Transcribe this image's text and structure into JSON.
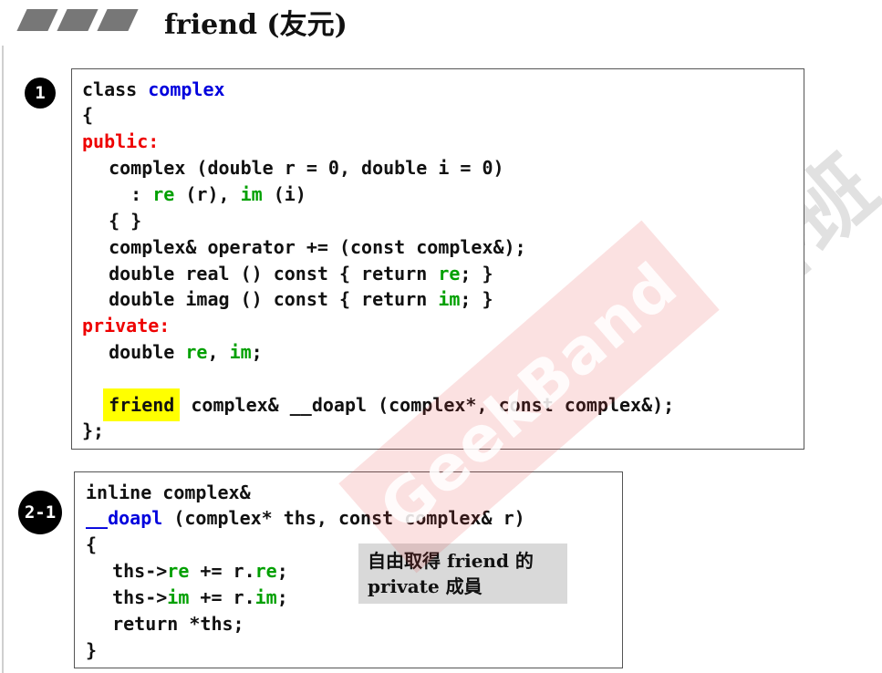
{
  "title": "friend (友元)",
  "badges": {
    "one": "1",
    "two": "2-1"
  },
  "watermark": {
    "brand": "GeekBand",
    "chinese": "极客班"
  },
  "note": {
    "line1": "自由取得 friend 的",
    "line2": "private 成員"
  },
  "code1": {
    "l1a": "class ",
    "l1b": "complex",
    "l2": "{",
    "l3": "public:",
    "l4": "  complex (double r = 0, double i = 0)",
    "l5a": "    : ",
    "l5b": "re",
    "l5c": " (r), ",
    "l5d": "im",
    "l5e": " (i)",
    "l6": "  { }",
    "l7": "  complex& operator += (const complex&);",
    "l8a": "  double real () const { return ",
    "l8b": "re",
    "l8c": "; }",
    "l9a": "  double imag () const { return ",
    "l9b": "im",
    "l9c": "; }",
    "l10": "private:",
    "l11a": "  double ",
    "l11b": "re",
    "l11c": ", ",
    "l11d": "im",
    "l11e": ";",
    "l12a": "  ",
    "l12b": "friend",
    "l12c": " complex& __doapl (complex*, const complex&);",
    "l13": "};"
  },
  "code2": {
    "l1": "inline complex&",
    "l2a": "__doapl",
    "l2b": " (complex* ths, const complex& r)",
    "l3": "{",
    "l4a": "  ths->",
    "l4b": "re",
    "l4c": " += r.",
    "l4d": "re",
    "l4e": ";",
    "l5a": "  ths->",
    "l5b": "im",
    "l5c": " += r.",
    "l5d": "im",
    "l5e": ";",
    "l6": "  return *ths;",
    "l7": "}"
  },
  "colors": {
    "class_name": "#0000dd",
    "access": "#ee0000",
    "member": "#00a000",
    "highlight": "#ffff00"
  }
}
